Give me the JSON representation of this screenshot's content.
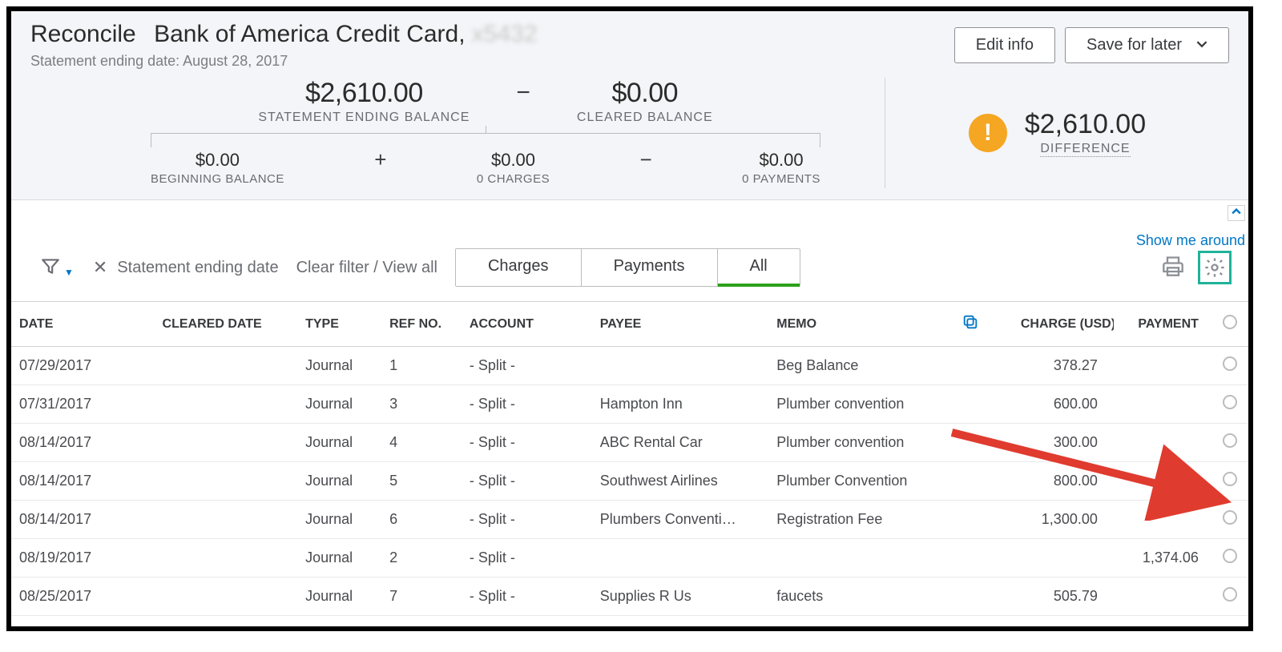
{
  "header": {
    "page_title": "Reconcile",
    "account_name": "Bank of America Credit Card,",
    "account_suffix": "x5432",
    "statement_line": "Statement ending date: August 28, 2017",
    "edit_btn": "Edit info",
    "save_btn": "Save for later"
  },
  "summary": {
    "ending_balance": {
      "value": "$2,610.00",
      "label": "STATEMENT ENDING BALANCE"
    },
    "cleared_balance": {
      "value": "$0.00",
      "label": "CLEARED BALANCE"
    },
    "beginning_balance": {
      "value": "$0.00",
      "label": "BEGINNING BALANCE"
    },
    "charges": {
      "value": "$0.00",
      "label": "0 CHARGES"
    },
    "payments": {
      "value": "$0.00",
      "label": "0 PAYMENTS"
    },
    "difference": {
      "value": "$2,610.00",
      "label": "DIFFERENCE"
    }
  },
  "body": {
    "show_me": "Show me around",
    "chip_label": "Statement ending date",
    "clear_filter": "Clear filter / View all",
    "tabs": {
      "charges": "Charges",
      "payments": "Payments",
      "all": "All"
    }
  },
  "columns": {
    "date": "DATE",
    "cleared": "CLEARED DATE",
    "type": "TYPE",
    "ref": "REF NO.",
    "account": "ACCOUNT",
    "payee": "PAYEE",
    "memo": "MEMO",
    "charge": "CHARGE (USD)",
    "payment": "PAYMENT"
  },
  "rows": [
    {
      "date": "07/29/2017",
      "cleared": "",
      "type": "Journal",
      "ref": "1",
      "account": "- Split -",
      "payee": "",
      "memo": "Beg Balance",
      "charge": "378.27",
      "payment": ""
    },
    {
      "date": "07/31/2017",
      "cleared": "",
      "type": "Journal",
      "ref": "3",
      "account": "- Split -",
      "payee": "Hampton Inn",
      "memo": "Plumber convention",
      "charge": "600.00",
      "payment": ""
    },
    {
      "date": "08/14/2017",
      "cleared": "",
      "type": "Journal",
      "ref": "4",
      "account": "- Split -",
      "payee": "ABC Rental Car",
      "memo": "Plumber convention",
      "charge": "300.00",
      "payment": ""
    },
    {
      "date": "08/14/2017",
      "cleared": "",
      "type": "Journal",
      "ref": "5",
      "account": "- Split -",
      "payee": "Southwest Airlines",
      "memo": "Plumber Convention",
      "charge": "800.00",
      "payment": ""
    },
    {
      "date": "08/14/2017",
      "cleared": "",
      "type": "Journal",
      "ref": "6",
      "account": "- Split -",
      "payee": "Plumbers Conventi…",
      "memo": "Registration Fee",
      "charge": "1,300.00",
      "payment": ""
    },
    {
      "date": "08/19/2017",
      "cleared": "",
      "type": "Journal",
      "ref": "2",
      "account": "- Split -",
      "payee": "",
      "memo": "",
      "charge": "",
      "payment": "1,374.06"
    },
    {
      "date": "08/25/2017",
      "cleared": "",
      "type": "Journal",
      "ref": "7",
      "account": "- Split -",
      "payee": "Supplies R Us",
      "memo": "faucets",
      "charge": "505.79",
      "payment": ""
    }
  ]
}
